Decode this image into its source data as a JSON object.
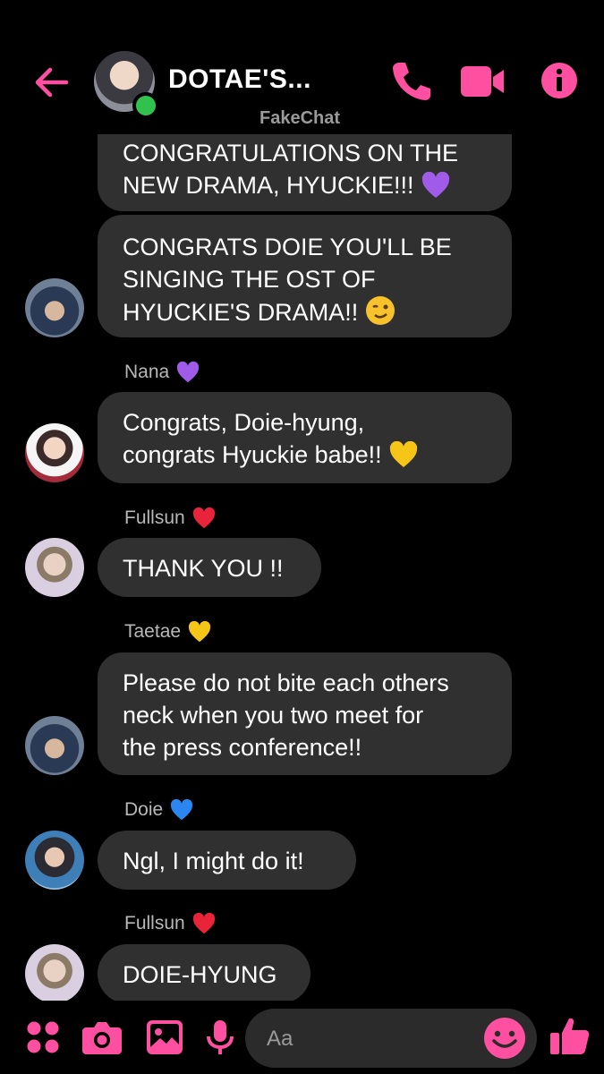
{
  "header": {
    "title": "DOTAE'S...",
    "subtitle": "FakeChat"
  },
  "messages": {
    "m1": {
      "lines": [
        "CONGRATULATIONS ON THE",
        "NEW DRAMA, HYUCKIE!!!"
      ],
      "emoji": "purple-heart"
    },
    "m2": {
      "lines": [
        "CONGRATS DOIE YOU'LL BE",
        "SINGING THE OST OF",
        "HYUCKIE'S DRAMA!!"
      ],
      "emoji": "winking-face"
    },
    "nana": {
      "sender": "Nana",
      "sender_heart": "purple-heart",
      "lines": [
        "Congrats, Doie-hyung,",
        "congrats Hyuckie babe!!"
      ],
      "emoji": "yellow-heart"
    },
    "fullsun1": {
      "sender": "Fullsun",
      "sender_heart": "red-heart",
      "lines": [
        "THANK YOU !!"
      ]
    },
    "taetae": {
      "sender": "Taetae",
      "sender_heart": "yellow-heart",
      "lines": [
        "Please do not bite each others",
        "neck when you two meet for",
        "the press conference!!"
      ]
    },
    "doie": {
      "sender": "Doie",
      "sender_heart": "blue-heart",
      "lines": [
        "Ngl, I might do it!"
      ]
    },
    "fullsun2": {
      "sender": "Fullsun",
      "sender_heart": "red-heart",
      "lines": [
        "DOIE-HYUNG"
      ]
    }
  },
  "composer": {
    "placeholder": "Aa"
  },
  "colors": {
    "accent": "#ff4fa0",
    "bubble": "#303030",
    "background": "#000000",
    "online": "#31c24d",
    "purple_heart": "#a05ce8",
    "yellow_heart": "#f5c518",
    "red_heart": "#e8233a",
    "blue_heart": "#2b86f0"
  },
  "icons": [
    "back-arrow-icon",
    "phone-icon",
    "video-icon",
    "info-icon",
    "apps-icon",
    "camera-icon",
    "gallery-icon",
    "microphone-icon",
    "emoji-icon",
    "like-icon"
  ]
}
